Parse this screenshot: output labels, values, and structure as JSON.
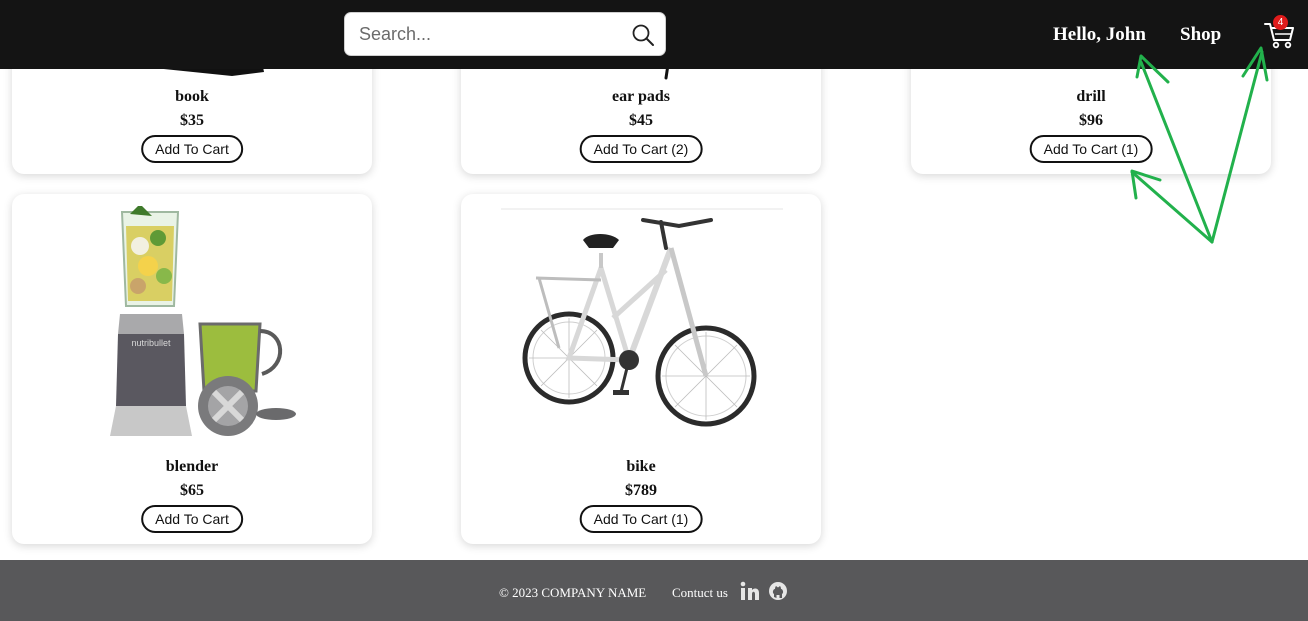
{
  "header": {
    "search_placeholder": "Search...",
    "greeting": "Hello, John",
    "shop_label": "Shop",
    "cart_count": "4",
    "search_icon": "search-icon",
    "cart_icon": "cart-icon"
  },
  "products": [
    {
      "name": "book",
      "price": "$35",
      "button": "Add To Cart"
    },
    {
      "name": "ear pads",
      "price": "$45",
      "button": "Add To Cart (2)"
    },
    {
      "name": "drill",
      "price": "$96",
      "button": "Add To Cart (1)"
    },
    {
      "name": "blender",
      "price": "$65",
      "button": "Add To Cart"
    },
    {
      "name": "bike",
      "price": "$789",
      "button": "Add To Cart (1)"
    }
  ],
  "footer": {
    "copyright": "© 2023 COMPANY NAME",
    "contact": "Contuct us",
    "social_icons": [
      "linkedin-icon",
      "github-icon"
    ]
  },
  "colors": {
    "header_bg": "#141414",
    "footer_bg": "#58585a",
    "badge": "#e01b1b",
    "annotation_arrows": "#22b14c"
  }
}
